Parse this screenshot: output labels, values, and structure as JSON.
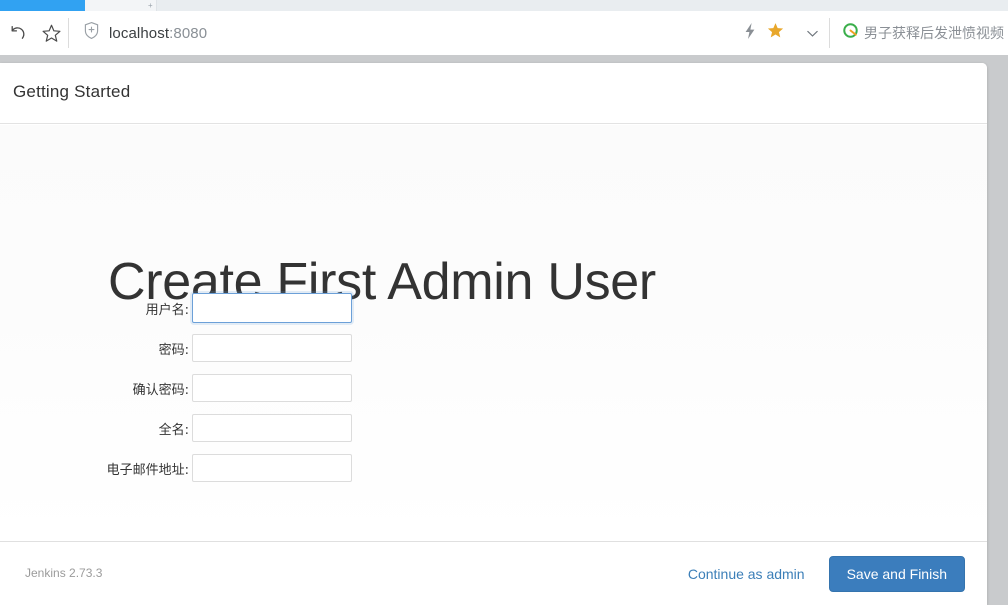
{
  "browser": {
    "tab": {
      "active_color": "#31a2f2",
      "new_tab_glyph": "+"
    },
    "nav": {
      "reload_icon": "reload-arrow-icon",
      "bookmark_icon": "star-outline-icon"
    },
    "address": {
      "security_icon": "shield-icon",
      "host": "localhost",
      "port": ":8080",
      "full_url": "localhost:8080"
    },
    "right_controls": {
      "lightning_icon": "lightning-bolt-icon",
      "favorite_icon": "star-filled-icon",
      "favorite_color": "#e8a72b",
      "chevron_icon": "chevron-down-icon"
    },
    "news": {
      "logo_icon": "qihoo-circle-icon",
      "logo_color": "#3aae4a",
      "headline": "男子获释后发泄愤视频"
    }
  },
  "page": {
    "header_title": "Getting Started",
    "heading": "Create First Admin User",
    "form": {
      "fields": [
        {
          "label": "用户名:",
          "value": "",
          "focused": true,
          "type": "text",
          "name": "username"
        },
        {
          "label": "密码:",
          "value": "",
          "focused": false,
          "type": "password",
          "name": "password"
        },
        {
          "label": "确认密码:",
          "value": "",
          "focused": false,
          "type": "password",
          "name": "confirm-password"
        },
        {
          "label": "全名:",
          "value": "",
          "focused": false,
          "type": "text",
          "name": "full-name"
        },
        {
          "label": "电子邮件地址:",
          "value": "",
          "focused": false,
          "type": "text",
          "name": "email"
        }
      ]
    },
    "footer": {
      "version": "Jenkins 2.73.3",
      "secondary_action": "Continue as admin",
      "primary_action": "Save and Finish",
      "primary_color": "#3b7dbd",
      "link_color": "#3c7fb8"
    }
  }
}
